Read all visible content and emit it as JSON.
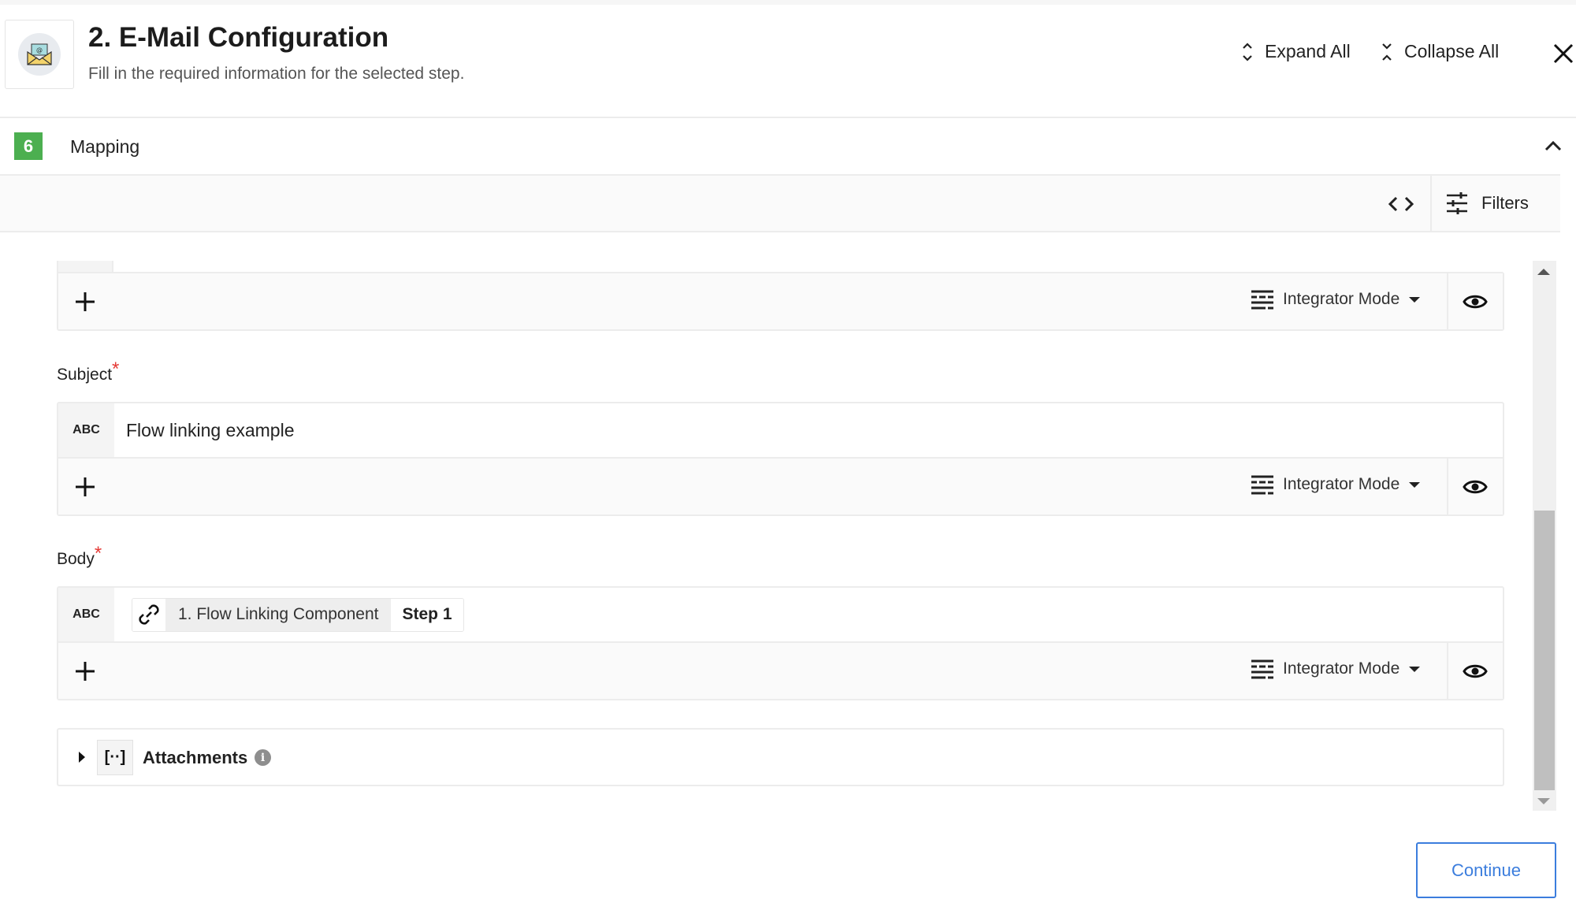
{
  "header": {
    "title": "2. E-Mail Configuration",
    "subtitle": "Fill in the required information for the selected step.",
    "icon": "email-envelope-icon",
    "expand_all_label": "Expand All",
    "collapse_all_label": "Collapse All"
  },
  "section": {
    "number": "6",
    "label": "Mapping",
    "badge_color": "#4caf50"
  },
  "toolbar": {
    "filters_label": "Filters"
  },
  "fields": [
    {
      "label": "",
      "required": false,
      "mode_label": "Integrator Mode"
    },
    {
      "label": "Subject",
      "required": true,
      "type_badge": "ABC",
      "value": "Flow linking example",
      "mode_label": "Integrator Mode"
    },
    {
      "label": "Body",
      "required": true,
      "type_badge": "ABC",
      "value_pill": {
        "name": "1. Flow Linking Component",
        "step": "Step 1"
      },
      "mode_label": "Integrator Mode"
    }
  ],
  "required_marker": "*",
  "attachments": {
    "array_badge": "[··]",
    "label": "Attachments",
    "info": "i"
  },
  "footer": {
    "continue_label": "Continue",
    "accent_color": "#3b7ddd"
  }
}
